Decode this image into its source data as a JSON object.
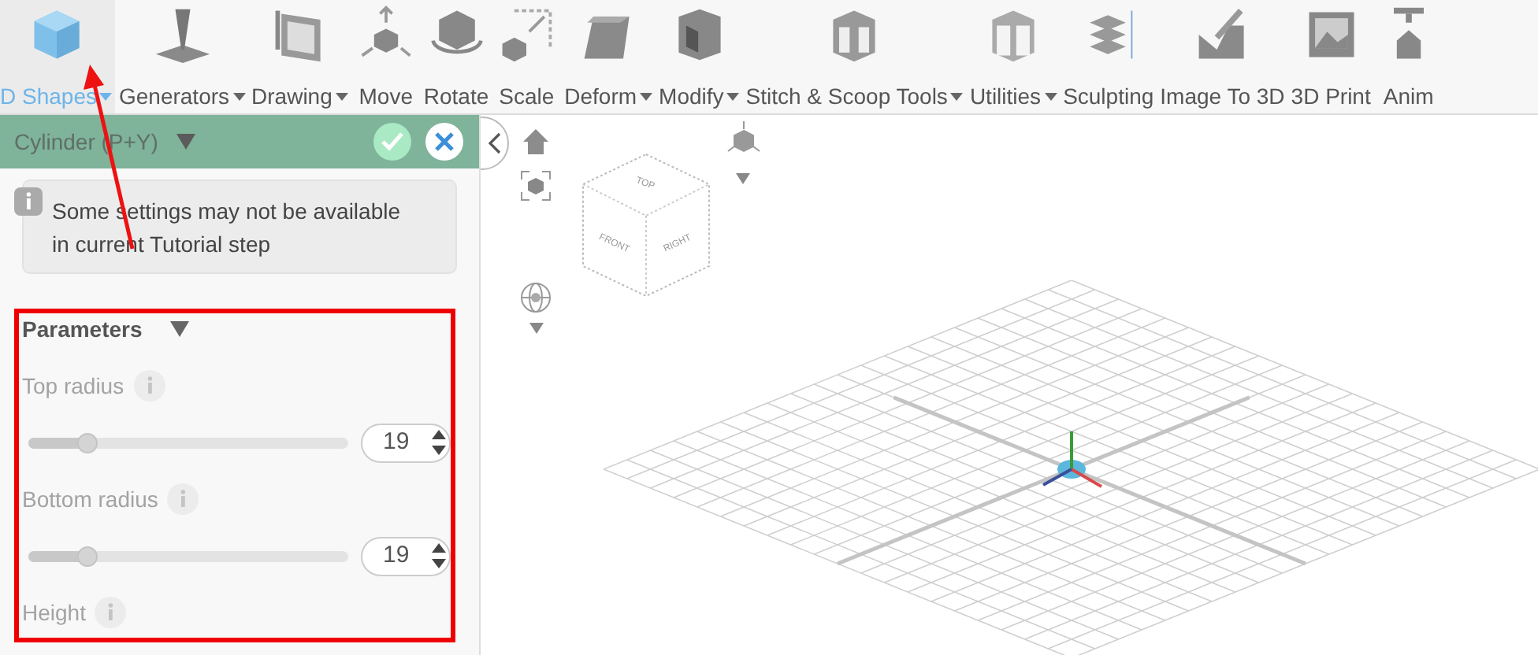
{
  "toolbar": {
    "items": [
      {
        "label": "D Shapes",
        "dropdown": true,
        "selected": true
      },
      {
        "label": "Generators",
        "dropdown": true,
        "selected": false
      },
      {
        "label": "Drawing",
        "dropdown": true,
        "selected": false
      },
      {
        "label": "Move",
        "dropdown": false,
        "selected": false
      },
      {
        "label": "Rotate",
        "dropdown": false,
        "selected": false
      },
      {
        "label": "Scale",
        "dropdown": false,
        "selected": false
      },
      {
        "label": "Deform",
        "dropdown": true,
        "selected": false
      },
      {
        "label": "Modify",
        "dropdown": true,
        "selected": false
      },
      {
        "label": "Stitch & Scoop Tools",
        "dropdown": true,
        "selected": false
      },
      {
        "label": "Utilities",
        "dropdown": true,
        "selected": false
      },
      {
        "label": "Sculpting",
        "dropdown": false,
        "selected": false
      },
      {
        "label": "Image To 3D",
        "dropdown": false,
        "selected": false
      },
      {
        "label": "3D Print",
        "dropdown": false,
        "selected": false
      },
      {
        "label": "Anim",
        "dropdown": false,
        "selected": false
      }
    ]
  },
  "panel": {
    "title": "Cylinder (P+Y)",
    "notice": "Some settings may not be available in current Tutorial step",
    "section": {
      "title": "Parameters",
      "expanded": true,
      "params": [
        {
          "kind": "slider",
          "label": "Top radius",
          "disabled": true,
          "level": 0.18,
          "value": "19"
        },
        {
          "kind": "slider",
          "label": "Bottom radius",
          "disabled": true,
          "level": 0.18,
          "value": "19"
        },
        {
          "kind": "label",
          "label": "Height",
          "disabled": true
        }
      ]
    }
  },
  "view_cube": {
    "faces": [
      "TOP",
      "FRONT",
      "RIGHT"
    ]
  }
}
